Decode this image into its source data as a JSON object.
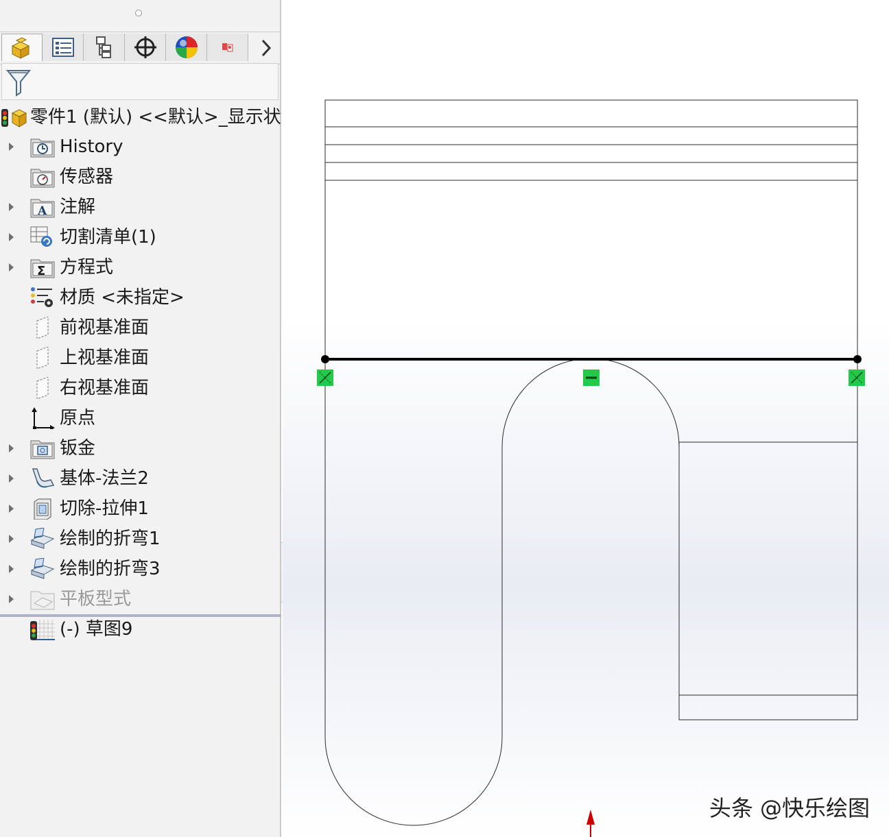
{
  "feature_tree": {
    "tabs": [
      {
        "name": "featuremanager-tab",
        "icon": "part-icon"
      },
      {
        "name": "propertymanager-tab",
        "icon": "property-list-icon"
      },
      {
        "name": "configurationmanager-tab",
        "icon": "configuration-icon"
      },
      {
        "name": "dimxpert-tab",
        "icon": "crosshair-icon"
      },
      {
        "name": "display-manager-tab",
        "icon": "appearance-sphere-icon"
      },
      {
        "name": "addin-tab",
        "icon": "addin-icon"
      }
    ],
    "root_label": "零件1 (默认) <<默认>_显示状",
    "items": [
      {
        "label": "History",
        "icon": "history-folder-icon"
      },
      {
        "label": "传感器",
        "icon": "sensor-folder-icon"
      },
      {
        "label": "注解",
        "icon": "annotation-folder-icon"
      },
      {
        "label": "切割清单(1)",
        "icon": "cut-list-icon"
      },
      {
        "label": "方程式",
        "icon": "equations-folder-icon"
      },
      {
        "label": "材质 <未指定>",
        "icon": "material-icon"
      },
      {
        "label": "前视基准面",
        "icon": "plane-icon"
      },
      {
        "label": "上视基准面",
        "icon": "plane-icon"
      },
      {
        "label": "右视基准面",
        "icon": "plane-icon"
      },
      {
        "label": "原点",
        "icon": "origin-icon"
      },
      {
        "label": "钣金",
        "icon": "sheet-metal-folder-icon"
      },
      {
        "label": "基体-法兰2",
        "icon": "base-flange-icon"
      },
      {
        "label": "切除-拉伸1",
        "icon": "extruded-cut-icon"
      },
      {
        "label": "绘制的折弯1",
        "icon": "sketched-bend-icon"
      },
      {
        "label": "绘制的折弯3",
        "icon": "sketched-bend-icon"
      },
      {
        "label": "平板型式",
        "icon": "flat-pattern-icon"
      },
      {
        "label": "(-) 草图9",
        "icon": "sketch-icon"
      }
    ]
  },
  "watermark": "头条 @快乐绘图",
  "colors": {
    "relation_marker": "#22c94a",
    "sketch_line": "#000000",
    "arrow": "#cc0000"
  }
}
